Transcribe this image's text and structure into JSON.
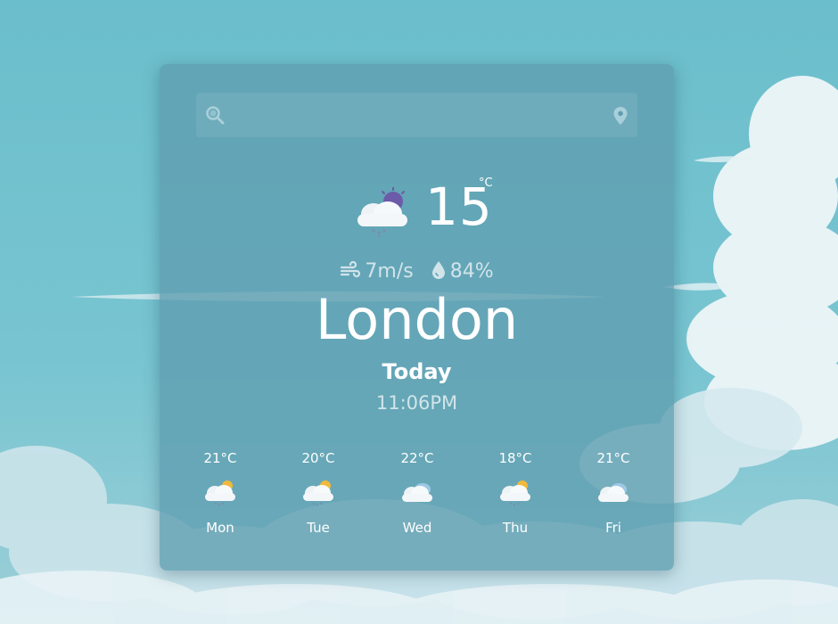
{
  "search": {
    "value": "",
    "placeholder": ""
  },
  "current": {
    "temperature": "15",
    "unit": "°C",
    "condition_icon": "cloud-sun-rain-icon",
    "wind": "7m/s",
    "humidity": "84%"
  },
  "city": "London",
  "day_label": "Today",
  "time": "11:06PM",
  "forecast": [
    {
      "temp": "21°C",
      "day": "Mon",
      "icon": "cloud-sun-rain-icon"
    },
    {
      "temp": "20°C",
      "day": "Tue",
      "icon": "cloud-sun-rain-icon"
    },
    {
      "temp": "22°C",
      "day": "Wed",
      "icon": "cloudy-icon"
    },
    {
      "temp": "18°C",
      "day": "Thu",
      "icon": "cloud-sun-rain-icon"
    },
    {
      "temp": "21°C",
      "day": "Fri",
      "icon": "cloudy-icon"
    }
  ]
}
